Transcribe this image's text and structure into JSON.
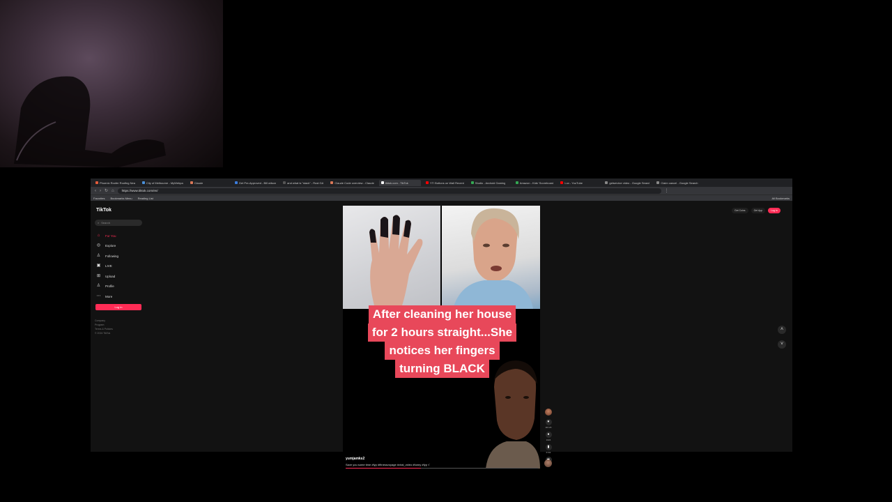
{
  "browser": {
    "tabs": [
      {
        "title": "Phoenix Roofer Roofing Nea",
        "color": "#e25c3b"
      },
      {
        "title": "City of Melbourne - MyWebpa",
        "color": "#4a90d9"
      },
      {
        "title": "Claude",
        "color": "#d97757"
      },
      {
        "title": "Get Pre-Approved - Bill wilson",
        "color": "#3b7ddd"
      },
      {
        "title": "and what is \"stack\" - Rust GA",
        "color": "#555555"
      },
      {
        "title": "Claude Code overview - Claude",
        "color": "#d97757"
      },
      {
        "title": "tiktok.com - TikTok",
        "color": "#ffffff",
        "active": true
      },
      {
        "title": "YT/ Buttons on Wall Recent",
        "color": "#ff0000"
      },
      {
        "title": "Studio - Android Gaming",
        "color": "#34a853"
      },
      {
        "title": "Amazon - Kids' Scoreboard",
        "color": "#34a853"
      },
      {
        "title": "Lux - YouTube",
        "color": "#ff0000"
      },
      {
        "title": "getservice video - Google Search",
        "color": "#888888"
      },
      {
        "title": "Claim cancel - Google Search",
        "color": "#888888"
      }
    ],
    "url": "https://www.tiktok.com/en/",
    "bookmarks": [
      "Favorites",
      "Bookmarks Menu",
      "Reading List"
    ],
    "bookmarks_right": "All Bookmarks"
  },
  "tiktok": {
    "logo": "TikTok",
    "search_placeholder": "Search",
    "sidebar": [
      {
        "label": "For You",
        "icon": "home-icon",
        "glyph": "⌂",
        "active": true
      },
      {
        "label": "Explore",
        "icon": "compass-icon",
        "glyph": "◎"
      },
      {
        "label": "Following",
        "icon": "following-icon",
        "glyph": "♙"
      },
      {
        "label": "LIVE",
        "icon": "live-icon",
        "glyph": "▣"
      },
      {
        "label": "Upload",
        "icon": "upload-icon",
        "glyph": "⊞"
      },
      {
        "label": "Profile",
        "icon": "profile-icon",
        "glyph": "♙"
      },
      {
        "label": "More",
        "icon": "more-icon",
        "glyph": "⋯"
      }
    ],
    "login_label": "Log in",
    "footer": [
      "Company",
      "Program",
      "Terms & Policies",
      "© 2024 TikTok"
    ],
    "top_right": {
      "get_coins": "Get Coins",
      "get_app": "Get App",
      "login": "Log in"
    },
    "video": {
      "caption_lines": [
        "After cleaning her house",
        "for 2 hours straight...She",
        "notices her fingers",
        "turning BLACK"
      ],
      "username": "yumjamks2",
      "description": "Save you some time #fyp #fitnessvoyage #viral_video #funny #fyp √",
      "progress": 0.39
    },
    "actions": [
      {
        "name": "like",
        "icon": "heart-icon",
        "glyph": "♥",
        "count": "116.2K"
      },
      {
        "name": "comment",
        "icon": "comment-icon",
        "glyph": "●",
        "count": "1024"
      },
      {
        "name": "save",
        "icon": "bookmark-icon",
        "glyph": "▮",
        "count": "6733"
      },
      {
        "name": "share",
        "icon": "share-icon",
        "glyph": "➦",
        "count": "1613"
      }
    ]
  }
}
